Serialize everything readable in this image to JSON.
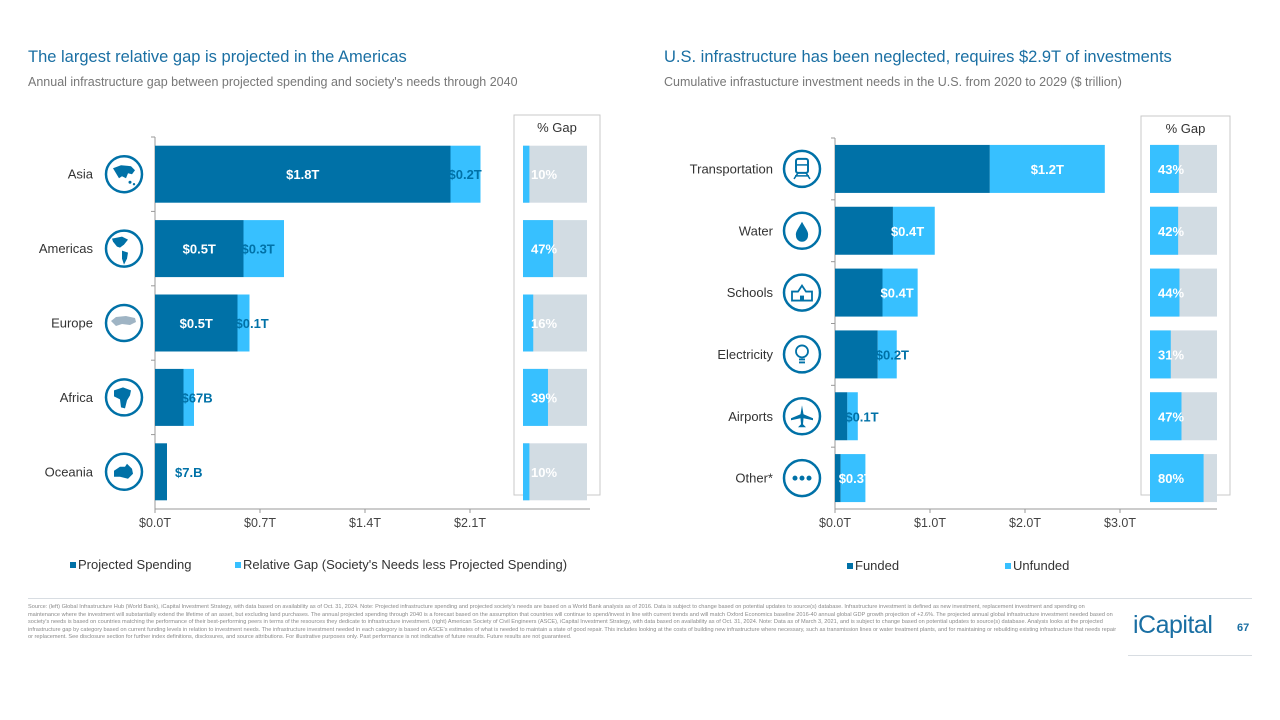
{
  "left": {
    "title": "The largest relative gap is projected in the Americas",
    "subtitle": "Annual infrastructure gap between projected spending and society's needs through 2040"
  },
  "right": {
    "title": "U.S. infrastructure has been neglected, requires $2.9T of investments",
    "subtitle": "Cumulative infrastucture investment needs in the U.S. from 2020 to 2029 ($ trillion)"
  },
  "colors": {
    "dark": "#0071a7",
    "light": "#37c0ff",
    "track": "#d2dce3",
    "axis": "#999999",
    "title": "#1a6fa3"
  },
  "chart_data": [
    {
      "type": "bar",
      "orientation": "horizontal-stacked",
      "title": "The largest relative gap is projected in the Americas",
      "subtitle": "Annual infrastructure gap between projected spending and society's needs through 2040",
      "categories": [
        "Asia",
        "Americas",
        "Europe",
        "Africa",
        "Oceania"
      ],
      "category_icons": [
        "asia-map-icon",
        "americas-map-icon",
        "europe-map-icon",
        "africa-map-icon",
        "oceania-map-icon"
      ],
      "series": [
        {
          "name": "Projected Spending",
          "color": "#0071a7",
          "values": [
            1.97,
            0.59,
            0.55,
            0.19,
            0.08
          ],
          "labels": [
            "$1.8T",
            "$0.5T",
            "$0.5T",
            "",
            ""
          ]
        },
        {
          "name": "Relative Gap (Society's Needs less Projected Spending)",
          "color": "#37c0ff",
          "values": [
            0.2,
            0.27,
            0.08,
            0.07,
            0.0
          ],
          "labels": [
            "$0.2T",
            "$0.3T",
            "$0.1T",
            "$67B",
            "$7.B"
          ]
        }
      ],
      "pct_gap": {
        "title": "% Gap",
        "values": [
          10,
          47,
          16,
          39,
          10
        ],
        "labels": [
          "10%",
          "47%",
          "16%",
          "39%",
          "10%"
        ]
      },
      "xlim": [
        0,
        2.85
      ],
      "xticks": [
        0,
        0.7,
        1.4,
        2.1
      ],
      "xtick_labels": [
        "$0.0T",
        "$0.7T",
        "$1.4T",
        "$2.1T"
      ],
      "legend": [
        "Projected Spending",
        "Relative Gap (Society's Needs less Projected Spending)"
      ],
      "legend_position": "bottom",
      "grid": false
    },
    {
      "type": "bar",
      "orientation": "horizontal-stacked",
      "title": "U.S. infrastructure has been neglected, requires $2.9T of investments",
      "subtitle": "Cumulative infrastucture investment needs in the U.S. from 2020 to 2029 ($ trillion)",
      "categories": [
        "Transportation",
        "Water",
        "Schools",
        "Electricity",
        "Airports",
        "Other*"
      ],
      "category_icons": [
        "train-icon",
        "water-drop-icon",
        "school-icon",
        "lightbulb-icon",
        "airplane-icon",
        "more-dots-icon"
      ],
      "series": [
        {
          "name": "Funded",
          "color": "#0071a7",
          "values": [
            1.63,
            0.61,
            0.5,
            0.45,
            0.13,
            0.06
          ],
          "labels": [
            "",
            "",
            "",
            "",
            "",
            ""
          ]
        },
        {
          "name": "Unfunded",
          "color": "#37c0ff",
          "values": [
            1.21,
            0.44,
            0.37,
            0.2,
            0.11,
            0.26
          ],
          "labels": [
            "$1.2T",
            "$0.4T",
            "$0.4T",
            "$0.2T",
            "$0.1T",
            "$0.3T"
          ]
        }
      ],
      "pct_gap": {
        "title": "% Gap",
        "values": [
          43,
          42,
          44,
          31,
          47,
          80
        ],
        "labels": [
          "43%",
          "42%",
          "44%",
          "31%",
          "47%",
          "80%"
        ]
      },
      "xlim": [
        0,
        4.0
      ],
      "xticks": [
        0,
        1,
        2,
        3
      ],
      "xtick_labels": [
        "$0.0T",
        "$1.0T",
        "$2.0T",
        "$3.0T"
      ],
      "legend": [
        "Funded",
        "Unfunded"
      ],
      "legend_position": "bottom",
      "grid": false
    }
  ],
  "footnote": "Source: (left) Global Infrastructure Hub (World Bank), iCapital Investment Strategy, with data based on availability as of Oct. 31, 2024. Note: Projected infrastructure spending and projected society's needs are based on a World Bank analysis as of 2016. Data is subject to change based on potential updates to source(s) database. Infrastructure investment is defined as new investment, replacement investment and spending on maintenance where the investment will substantially extend the lifetime of an asset, but excluding land purchases. The annual projected spending through 2040 is a forecast based on the assumption that countries will continue to spend/invest in line with current trends and will match Oxford Economics baseline 2016-40 annual global GDP growth projection of +2.6%. The projected annual global infrastructure investment needed based on society's needs is based on countries matching the performance of their best-performing peers in terms of the resources they dedicate to infrastructure investment. (right) American Society of Civil Engineers (ASCE), iCapital Investment Strategy, with data based on availability as of Oct. 31, 2024. Note: Data as of March 3, 2021, and is subject to change based on potential updates to source(s) database. Analysis looks at the projected infrastructure gap by category based on current funding levels in relation to investment needs. The infrastructure investment needed in each category is based on ASCE's estimates of what is needed to maintain a state of good repair. This includes looking at the costs of building new infrastructure where necessary, such as transmission lines or water treatment plants, and for maintaining or rebuilding existing infrastructure that needs repair or replacement. See disclosure section for further index definitions, disclosures, and source attributions. For illustrative purposes only. Past performance is not indicative of future results. Future results are not guaranteed.",
  "brand": {
    "logo": "iCapital",
    "page_number": "67"
  }
}
